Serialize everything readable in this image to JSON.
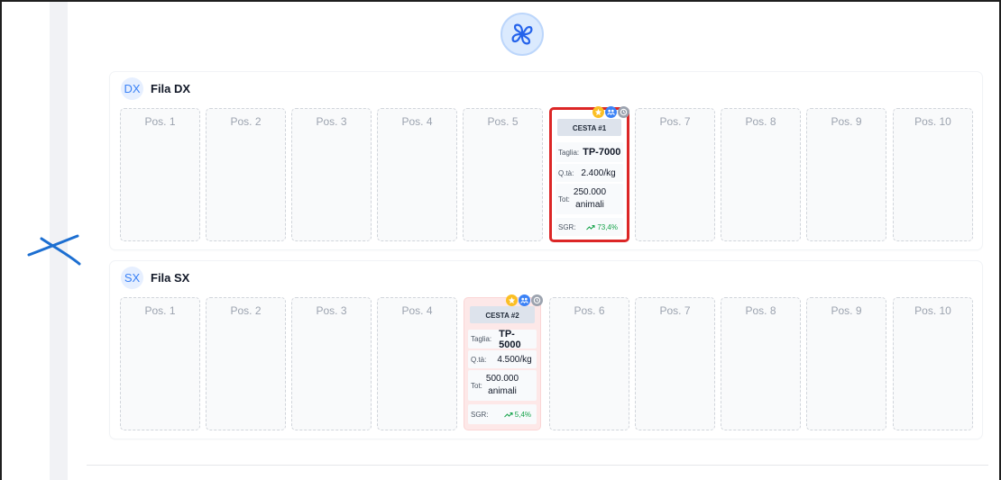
{
  "colors": {
    "accent": "#3b82f6",
    "selected_border": "#dc2626",
    "sgr_green": "#16a34a"
  },
  "logo": {
    "icon": "fan-icon"
  },
  "rows": [
    {
      "badge": "DX",
      "title": "Fila DX",
      "slots": [
        "Pos. 1",
        "Pos. 2",
        "Pos. 3",
        "Pos. 4",
        "Pos. 5",
        "",
        "Pos. 7",
        "Pos. 8",
        "Pos. 9",
        "Pos. 10"
      ],
      "basket": {
        "name": "CESTA #1",
        "size_label": "Taglia:",
        "size": "TP-7000",
        "qty_label": "Q.tà:",
        "qty": "2.400/kg",
        "tot_label": "Tot:",
        "tot_line1": "250.000",
        "tot_line2": "animali",
        "sgr_label": "SGR:",
        "sgr": "73,4%",
        "icons": [
          "star-icon",
          "group-icon",
          "clock-icon"
        ]
      }
    },
    {
      "badge": "SX",
      "title": "Fila SX",
      "slots": [
        "Pos. 1",
        "Pos. 2",
        "Pos. 3",
        "Pos. 4",
        "",
        "Pos. 6",
        "Pos. 7",
        "Pos. 8",
        "Pos. 9",
        "Pos. 10"
      ],
      "basket": {
        "name": "CESTA #2",
        "size_label": "Taglia:",
        "size": "TP-5000",
        "qty_label": "Q.tà:",
        "qty": "4.500/kg",
        "tot_label": "Tot:",
        "tot_line1": "500.000",
        "tot_line2": "animali",
        "sgr_label": "SGR:",
        "sgr": "5,4%",
        "icons": [
          "star-icon",
          "group-icon",
          "clock-icon"
        ]
      }
    }
  ]
}
